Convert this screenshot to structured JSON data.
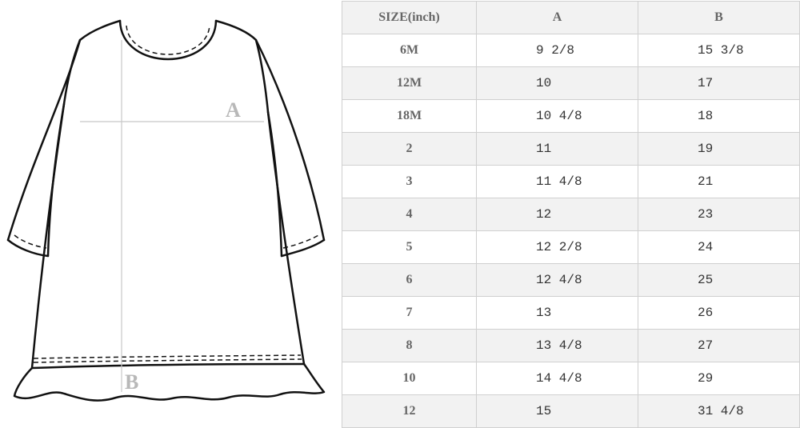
{
  "diagram": {
    "label_a": "A",
    "label_b": "B"
  },
  "size_table": {
    "headers": [
      "SIZE(inch)",
      "A",
      "B"
    ],
    "rows": [
      {
        "size": "6M",
        "a": "9 2/8",
        "b": "15 3/8"
      },
      {
        "size": "12M",
        "a": "10",
        "b": "17"
      },
      {
        "size": "18M",
        "a": "10 4/8",
        "b": "18"
      },
      {
        "size": "2",
        "a": "11",
        "b": "19"
      },
      {
        "size": "3",
        "a": "11 4/8",
        "b": "21"
      },
      {
        "size": "4",
        "a": "12",
        "b": "23"
      },
      {
        "size": "5",
        "a": "12 2/8",
        "b": "24"
      },
      {
        "size": "6",
        "a": "12 4/8",
        "b": "25"
      },
      {
        "size": "7",
        "a": "13",
        "b": "26"
      },
      {
        "size": "8",
        "a": "13 4/8",
        "b": "27"
      },
      {
        "size": "10",
        "a": "14 4/8",
        "b": "29"
      },
      {
        "size": "12",
        "a": "15",
        "b": "31 4/8"
      }
    ]
  }
}
